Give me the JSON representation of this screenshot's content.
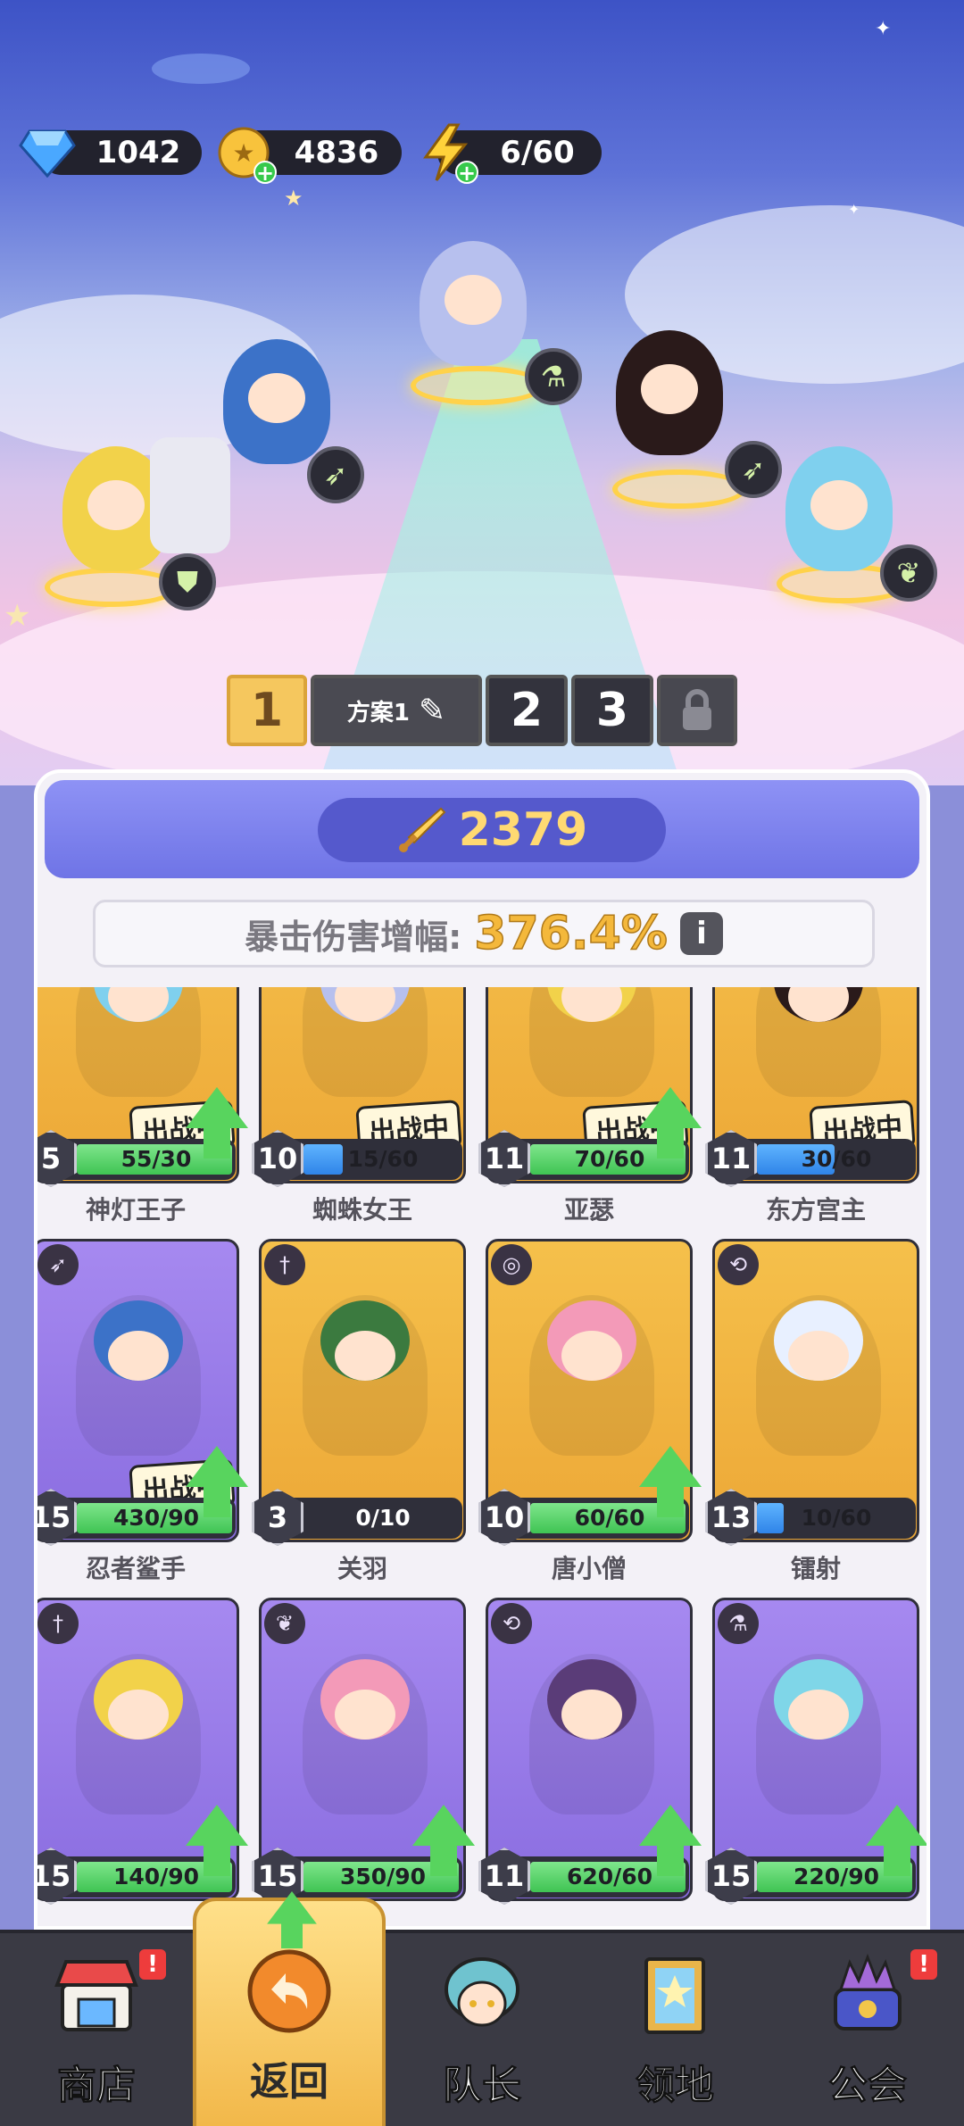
{
  "resources": {
    "gems": "1042",
    "coins": "4836",
    "energy": "6/60"
  },
  "formation": {
    "tabs": [
      "1",
      "方案1",
      "2",
      "3"
    ],
    "active_tab": "1"
  },
  "power": {
    "value": "2379"
  },
  "crit": {
    "label": "暴击伤害增幅:",
    "value": "376.4%"
  },
  "deployed_label": "出战中",
  "heroes": [
    {
      "name": "神灯王子",
      "level": "5",
      "progress": "55/30",
      "fill": 1.0,
      "bar": "green",
      "deployed": true,
      "upgrade": true,
      "card": "gold",
      "class_icon": "wing-icon"
    },
    {
      "name": "蜘蛛女王",
      "level": "10",
      "progress": "15/60",
      "fill": 0.25,
      "bar": "blue",
      "deployed": true,
      "upgrade": false,
      "card": "gold",
      "class_icon": "potion-icon"
    },
    {
      "name": "亚瑟",
      "level": "11",
      "progress": "70/60",
      "fill": 1.0,
      "bar": "green",
      "deployed": true,
      "upgrade": true,
      "card": "gold",
      "class_icon": "shield-icon"
    },
    {
      "name": "东方宫主",
      "level": "11",
      "progress": "30/60",
      "fill": 0.5,
      "bar": "blue",
      "deployed": true,
      "upgrade": false,
      "card": "gold",
      "class_icon": "bow-icon"
    },
    {
      "name": "忍者鲨手",
      "level": "15",
      "progress": "430/90",
      "fill": 1.0,
      "bar": "green",
      "deployed": true,
      "upgrade": true,
      "card": "purple",
      "class_icon": "bow-icon"
    },
    {
      "name": "关羽",
      "level": "3",
      "progress": "0/10",
      "fill": 0.0,
      "bar": "green",
      "deployed": false,
      "upgrade": false,
      "card": "gold",
      "class_icon": "sword-icon"
    },
    {
      "name": "唐小僧",
      "level": "10",
      "progress": "60/60",
      "fill": 1.0,
      "bar": "green",
      "deployed": false,
      "upgrade": true,
      "card": "gold",
      "class_icon": "spiral-icon"
    },
    {
      "name": "镭射",
      "level": "13",
      "progress": "10/60",
      "fill": 0.17,
      "bar": "blue",
      "deployed": false,
      "upgrade": false,
      "card": "gold",
      "class_icon": "magic-icon"
    },
    {
      "name": "",
      "level": "15",
      "progress": "140/90",
      "fill": 1.0,
      "bar": "green",
      "deployed": false,
      "upgrade": true,
      "card": "purple",
      "class_icon": "sword-icon"
    },
    {
      "name": "",
      "level": "15",
      "progress": "350/90",
      "fill": 1.0,
      "bar": "green",
      "deployed": false,
      "upgrade": true,
      "card": "purple",
      "class_icon": "wing-icon"
    },
    {
      "name": "",
      "level": "11",
      "progress": "620/60",
      "fill": 1.0,
      "bar": "green",
      "deployed": false,
      "upgrade": true,
      "card": "purple",
      "class_icon": "magic-icon"
    },
    {
      "name": "",
      "level": "15",
      "progress": "220/90",
      "fill": 1.0,
      "bar": "green",
      "deployed": false,
      "upgrade": true,
      "card": "purple",
      "class_icon": "potion-icon"
    }
  ],
  "nav": [
    {
      "label": "商店",
      "icon": "shop-icon",
      "alert": "!"
    },
    {
      "label": "返回",
      "icon": "return-icon",
      "alert": ""
    },
    {
      "label": "队长",
      "icon": "captain-icon",
      "alert": ""
    },
    {
      "label": "领地",
      "icon": "territory-icon",
      "alert": ""
    },
    {
      "label": "公会",
      "icon": "guild-icon",
      "alert": "!"
    }
  ],
  "colors": {
    "gold": "#f5c04b",
    "purple": "#a689f0",
    "accent_power": "#ffd972",
    "crit_value": "#f4b83b"
  }
}
